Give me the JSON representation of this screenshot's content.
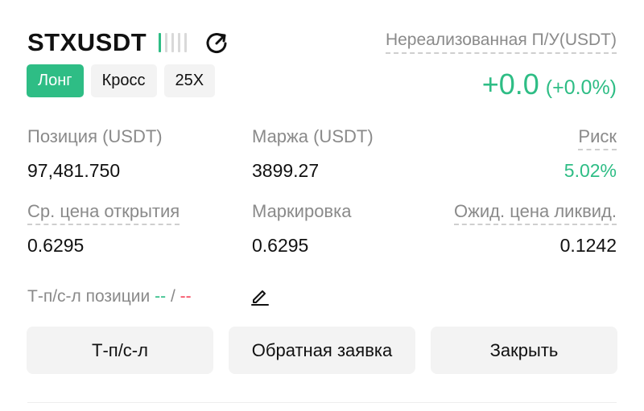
{
  "position": {
    "symbol": "STXUSDT",
    "leverage_bars": {
      "total": 5,
      "active": 1
    },
    "tags": {
      "side": "Лонг",
      "margin_mode": "Кросс",
      "leverage": "25X"
    },
    "unrealized_pnl": {
      "label": "Нереализованная П/У(USDT)",
      "value": "+0.0",
      "percent": "(+0.0%)"
    },
    "stats": {
      "size": {
        "label": "Позиция (USDT)",
        "value": "97,481.750"
      },
      "margin": {
        "label": "Маржа (USDT)",
        "value": "3899.27"
      },
      "risk": {
        "label": "Риск",
        "value": "5.02%"
      },
      "entry_price": {
        "label": "Ср. цена открытия",
        "value": "0.6295"
      },
      "mark_price": {
        "label": "Маркировка",
        "value": "0.6295"
      },
      "liq_price": {
        "label": "Ожид. цена ликвид.",
        "value": "0.1242"
      }
    },
    "tpsl": {
      "label": "Т-п/с-л позиции",
      "tp": "--",
      "separator": "/",
      "sl": "--"
    },
    "buttons": {
      "tpsl": "Т-п/с-л",
      "reverse": "Обратная заявка",
      "close": "Закрыть"
    }
  },
  "colors": {
    "accent_green": "#2ebd85",
    "accent_red": "#f6465d",
    "muted": "#8a8a8a"
  },
  "icons": {
    "share": "share-icon",
    "edit": "edit-pencil-icon"
  }
}
